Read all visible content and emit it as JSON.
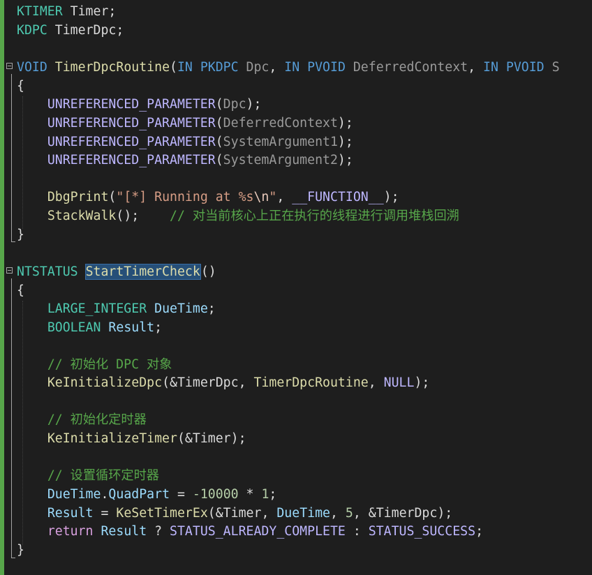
{
  "editor": {
    "globals": {
      "timer_type": "KTIMER",
      "timer_name": "Timer",
      "dpc_type": "KDPC",
      "dpc_name": "TimerDpc"
    },
    "routine": {
      "return_type": "VOID",
      "name": "TimerDpcRoutine",
      "in": "IN",
      "p1_type": "PKDPC",
      "p1_name": "Dpc",
      "p2_type": "PVOID",
      "p2_name": "DeferredContext",
      "p3_type": "PVOID",
      "p3_cut": "S",
      "open_brace": "{",
      "close_brace": "}",
      "unref": "UNREFERENCED_PARAMETER",
      "unref_args": [
        "Dpc",
        "DeferredContext",
        "SystemArgument1",
        "SystemArgument2"
      ],
      "dbgprint": "DbgPrint",
      "fmt_a": "\"[*] Running at %s",
      "fmt_esc": "\\n",
      "fmt_b": "\"",
      "function_macro": "__FUNCTION__",
      "stackwalk": "StackWalk",
      "stackwalk_comment": "// 对当前核心上正在执行的线程进行调用堆栈回溯"
    },
    "check": {
      "return_type": "NTSTATUS",
      "name": "StartTimerCheck",
      "open_brace": "{",
      "close_brace": "}",
      "large_int": "LARGE_INTEGER",
      "duetime": "DueTime",
      "boolean": "BOOLEAN",
      "result": "Result",
      "comment_dpc": "// 初始化 DPC 对象",
      "init_dpc": "KeInitializeDpc",
      "timer_dpc_ref": "&TimerDpc",
      "routine_ref": "TimerDpcRoutine",
      "null": "NULL",
      "comment_timer": "// 初始化定时器",
      "init_timer": "KeInitializeTimer",
      "timer_ref": "&Timer",
      "comment_cycle": "// 设置循环定时器",
      "quadpart": "QuadPart",
      "neg_value": "-10000",
      "mult": "1",
      "set_timer": "KeSetTimerEx",
      "period": "5",
      "ret_kw": "return",
      "status_complete": "STATUS_ALREADY_COMPLETE",
      "status_success": "STATUS_SUCCESS"
    }
  }
}
